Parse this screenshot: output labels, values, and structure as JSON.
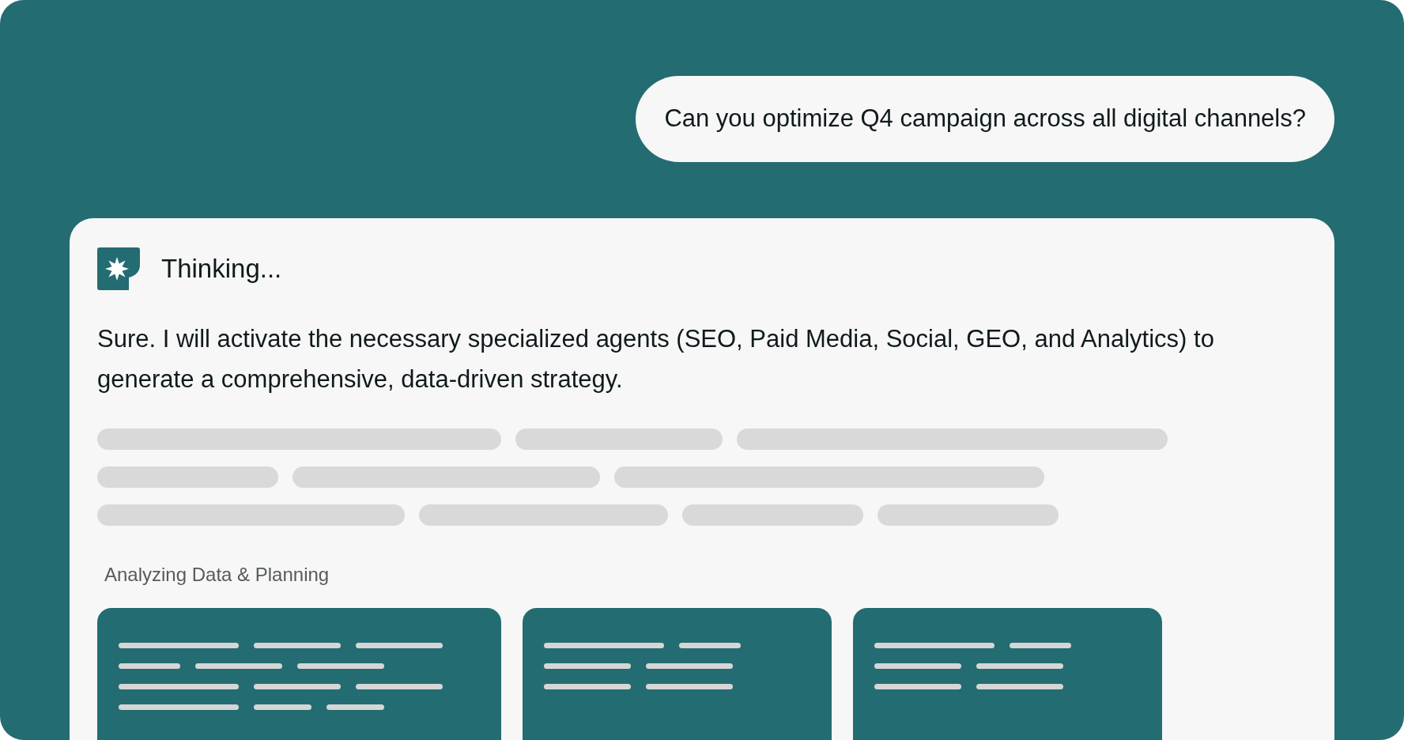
{
  "user_message": "Can you optimize Q4 campaign across all digital channels?",
  "assistant": {
    "status": "Thinking...",
    "message": "Sure. I will activate the necessary specialized agents (SEO, Paid Media, Social, GEO, and Analytics) to generate a comprehensive, data-driven strategy.",
    "section_label": "Analyzing Data & Planning"
  }
}
